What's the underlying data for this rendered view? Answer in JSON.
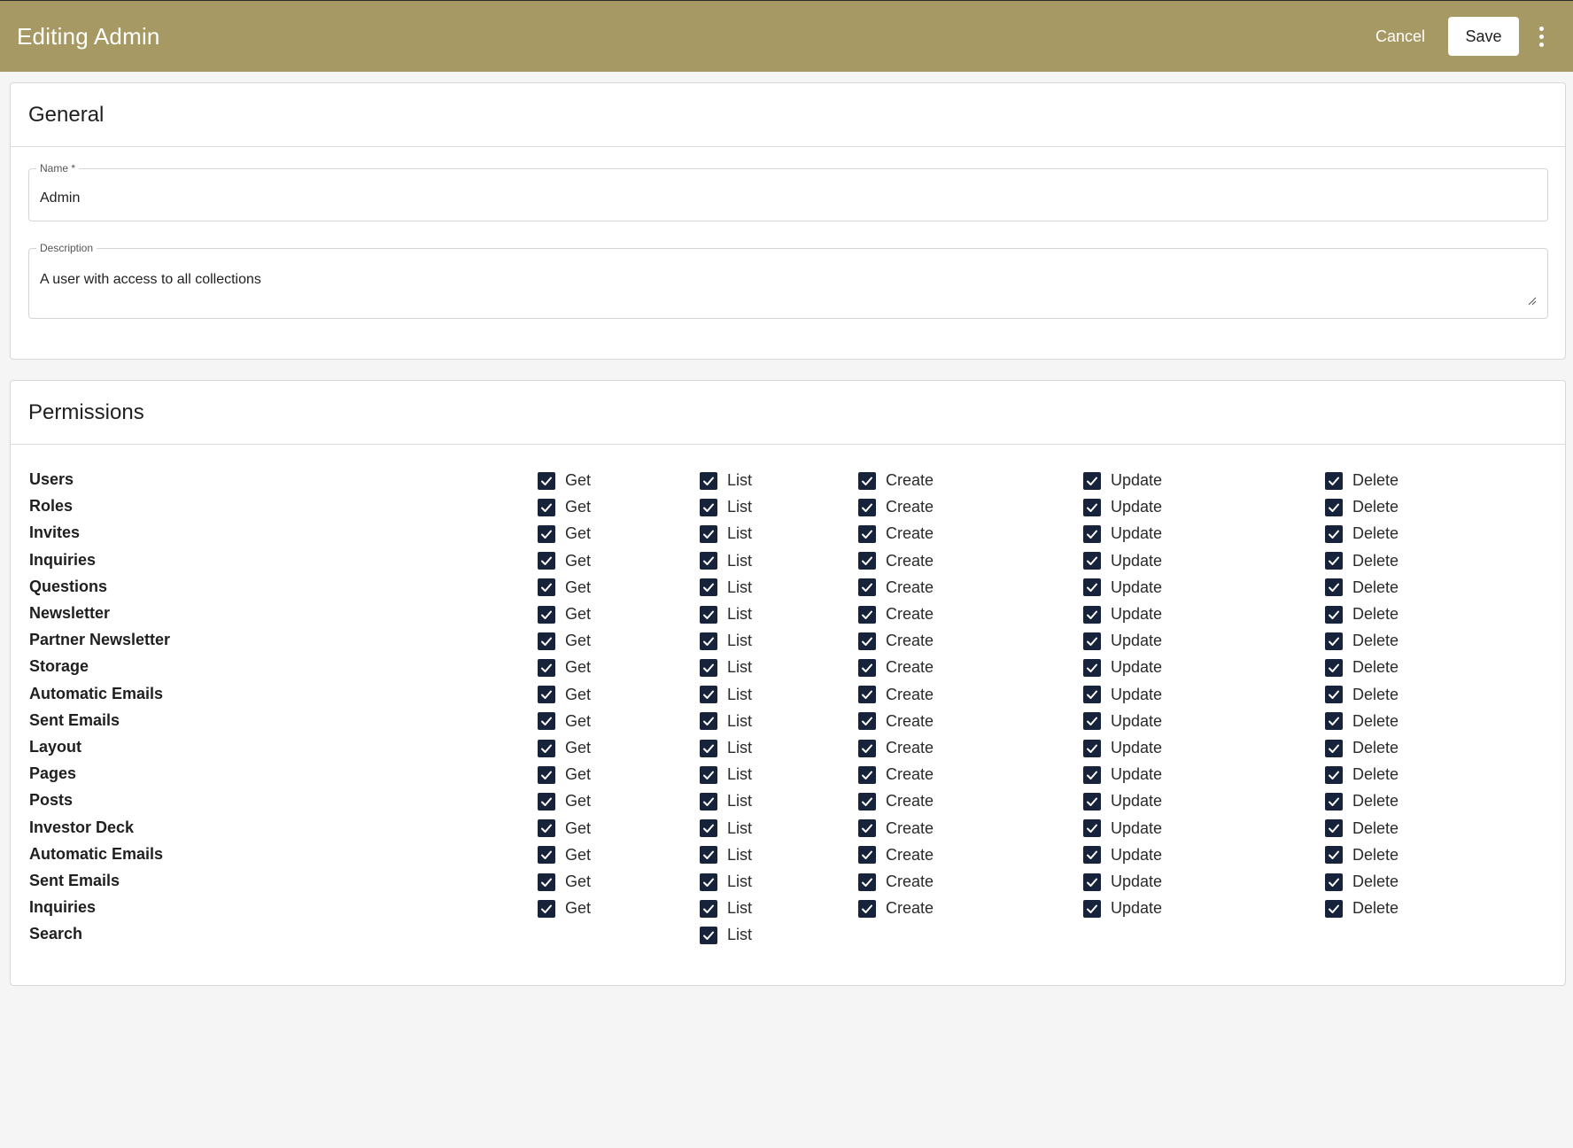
{
  "topbar": {
    "title": "Editing Admin",
    "cancel_label": "Cancel",
    "save_label": "Save",
    "more_icon": "more-vert-icon"
  },
  "general": {
    "heading": "General",
    "name_label": "Name *",
    "name_value": "Admin",
    "description_label": "Description",
    "description_value": "A user with access to all collections"
  },
  "permissions": {
    "heading": "Permissions",
    "action_labels": [
      "Get",
      "List",
      "Create",
      "Update",
      "Delete"
    ],
    "rows": [
      {
        "name": "Users",
        "actions": [
          "Get",
          "List",
          "Create",
          "Update",
          "Delete"
        ]
      },
      {
        "name": "Roles",
        "actions": [
          "Get",
          "List",
          "Create",
          "Update",
          "Delete"
        ]
      },
      {
        "name": "Invites",
        "actions": [
          "Get",
          "List",
          "Create",
          "Update",
          "Delete"
        ]
      },
      {
        "name": "Inquiries",
        "actions": [
          "Get",
          "List",
          "Create",
          "Update",
          "Delete"
        ]
      },
      {
        "name": "Questions",
        "actions": [
          "Get",
          "List",
          "Create",
          "Update",
          "Delete"
        ]
      },
      {
        "name": "Newsletter",
        "actions": [
          "Get",
          "List",
          "Create",
          "Update",
          "Delete"
        ]
      },
      {
        "name": "Partner Newsletter",
        "actions": [
          "Get",
          "List",
          "Create",
          "Update",
          "Delete"
        ]
      },
      {
        "name": "Storage",
        "actions": [
          "Get",
          "List",
          "Create",
          "Update",
          "Delete"
        ]
      },
      {
        "name": "Automatic Emails",
        "actions": [
          "Get",
          "List",
          "Create",
          "Update",
          "Delete"
        ]
      },
      {
        "name": "Sent Emails",
        "actions": [
          "Get",
          "List",
          "Create",
          "Update",
          "Delete"
        ]
      },
      {
        "name": "Layout",
        "actions": [
          "Get",
          "List",
          "Create",
          "Update",
          "Delete"
        ]
      },
      {
        "name": "Pages",
        "actions": [
          "Get",
          "List",
          "Create",
          "Update",
          "Delete"
        ]
      },
      {
        "name": "Posts",
        "actions": [
          "Get",
          "List",
          "Create",
          "Update",
          "Delete"
        ]
      },
      {
        "name": "Investor Deck",
        "actions": [
          "Get",
          "List",
          "Create",
          "Update",
          "Delete"
        ]
      },
      {
        "name": "Automatic Emails",
        "actions": [
          "Get",
          "List",
          "Create",
          "Update",
          "Delete"
        ]
      },
      {
        "name": "Sent Emails",
        "actions": [
          "Get",
          "List",
          "Create",
          "Update",
          "Delete"
        ]
      },
      {
        "name": "Inquiries",
        "actions": [
          "Get",
          "List",
          "Create",
          "Update",
          "Delete"
        ]
      },
      {
        "name": "Search",
        "actions": [
          "List"
        ]
      }
    ],
    "checked_all": true
  },
  "colors": {
    "topbar_bg": "#a79963",
    "checkbox_fill": "#17223b",
    "page_bg": "#f5f5f5"
  }
}
